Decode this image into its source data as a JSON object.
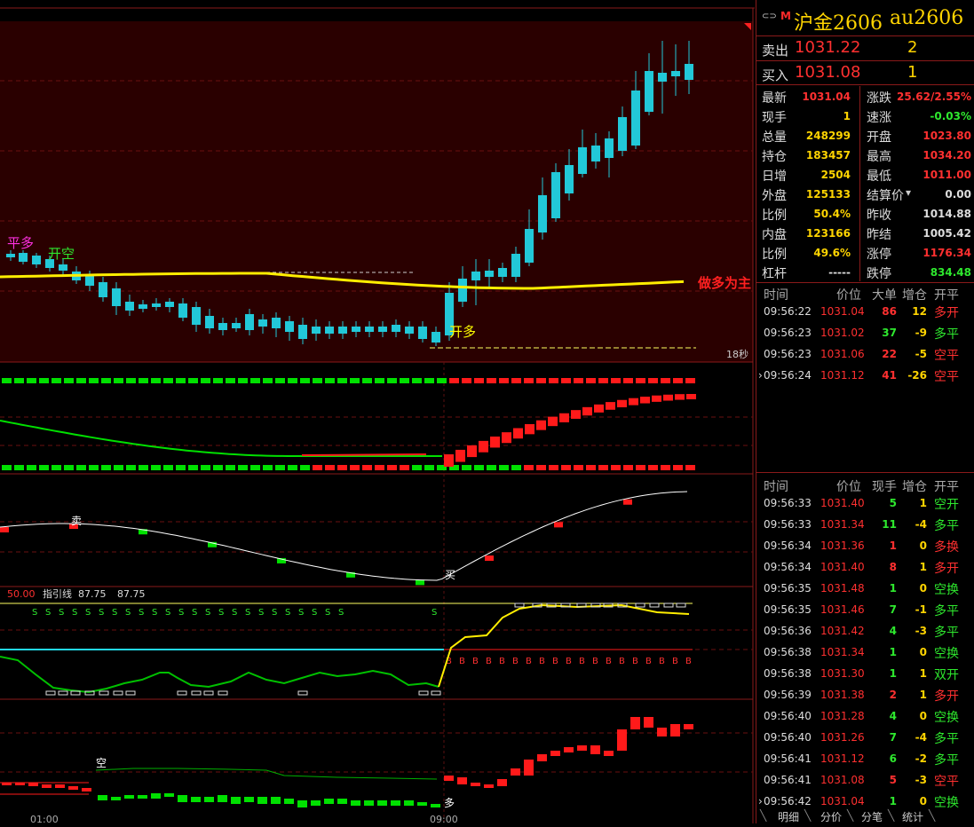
{
  "header": {
    "icon": "link-icon",
    "badge": "M",
    "name": "沪金2606",
    "code": "au2606"
  },
  "ask": {
    "label": "卖出",
    "price": "1031.22",
    "volume": "2"
  },
  "bid": {
    "label": "买入",
    "price": "1031.08",
    "volume": "1"
  },
  "stats_left": [
    {
      "k": "最新",
      "v": "1031.04",
      "color": "#ff3030"
    },
    {
      "k": "现手",
      "v": "1",
      "color": "#ffd400"
    },
    {
      "k": "总量",
      "v": "248299",
      "color": "#ffd400"
    },
    {
      "k": "持仓",
      "v": "183457",
      "color": "#ffd400"
    },
    {
      "k": "日增",
      "v": "2504",
      "color": "#ffd400"
    },
    {
      "k": "外盘",
      "v": "125133",
      "color": "#ffd400"
    },
    {
      "k": "比例",
      "v": "50.4%",
      "color": "#ffd400"
    },
    {
      "k": "内盘",
      "v": "123166",
      "color": "#ffd400"
    },
    {
      "k": "比例",
      "v": "49.6%",
      "color": "#ffd400"
    },
    {
      "k": "杠杆",
      "v": "-----",
      "color": "#ddd"
    }
  ],
  "stats_right": [
    {
      "k": "涨跌",
      "v": "25.62/2.55%",
      "color": "#ff3030"
    },
    {
      "k": "速涨",
      "v": "-0.03%",
      "color": "#2ee82e"
    },
    {
      "k": "开盘",
      "v": "1023.80",
      "color": "#ff3030"
    },
    {
      "k": "最高",
      "v": "1034.20",
      "color": "#ff3030"
    },
    {
      "k": "最低",
      "v": "1011.00",
      "color": "#ff3030"
    },
    {
      "k": "结算价",
      "v": "0.00",
      "color": "#ddd",
      "dropdown": true
    },
    {
      "k": "昨收",
      "v": "1014.88",
      "color": "#ddd"
    },
    {
      "k": "昨结",
      "v": "1005.42",
      "color": "#ddd"
    },
    {
      "k": "涨停",
      "v": "1176.34",
      "color": "#ff3030"
    },
    {
      "k": "跌停",
      "v": "834.48",
      "color": "#2ee82e"
    }
  ],
  "big_orders": {
    "headers": [
      "时间",
      "价位",
      "大单",
      "增仓",
      "开平"
    ],
    "rows": [
      {
        "t": "09:56:22",
        "p": "1031.04",
        "v": "86",
        "c": "12",
        "k": "多开",
        "vc": "#ff3030",
        "cc": "#ffd400",
        "kc": "#ff3030"
      },
      {
        "t": "09:56:23",
        "p": "1031.02",
        "v": "37",
        "c": "-9",
        "k": "多平",
        "vc": "#2ee82e",
        "cc": "#ffd400",
        "kc": "#2ee82e"
      },
      {
        "t": "09:56:23",
        "p": "1031.06",
        "v": "22",
        "c": "-5",
        "k": "空平",
        "vc": "#ff3030",
        "cc": "#ffd400",
        "kc": "#ff3030"
      },
      {
        "t": "09:56:24",
        "p": "1031.12",
        "v": "41",
        "c": "-26",
        "k": "空平",
        "vc": "#ff3030",
        "cc": "#ffd400",
        "kc": "#ff3030",
        "arrow": true
      }
    ]
  },
  "ticks": {
    "headers": [
      "时间",
      "价位",
      "现手",
      "增仓",
      "开平"
    ],
    "rows": [
      {
        "t": "09:56:33",
        "p": "1031.40",
        "v": "5",
        "c": "1",
        "k": "空开",
        "vc": "#2ee82e",
        "cc": "#ffd400",
        "kc": "#2ee82e"
      },
      {
        "t": "09:56:33",
        "p": "1031.34",
        "v": "11",
        "c": "-4",
        "k": "多平",
        "vc": "#2ee82e",
        "cc": "#ffd400",
        "kc": "#2ee82e"
      },
      {
        "t": "09:56:34",
        "p": "1031.36",
        "v": "1",
        "c": "0",
        "k": "多换",
        "vc": "#ff3030",
        "cc": "#ffd400",
        "kc": "#ff3030"
      },
      {
        "t": "09:56:34",
        "p": "1031.40",
        "v": "8",
        "c": "1",
        "k": "多开",
        "vc": "#ff3030",
        "cc": "#ffd400",
        "kc": "#ff3030"
      },
      {
        "t": "09:56:35",
        "p": "1031.48",
        "v": "1",
        "c": "0",
        "k": "空换",
        "vc": "#2ee82e",
        "cc": "#ffd400",
        "kc": "#2ee82e"
      },
      {
        "t": "09:56:35",
        "p": "1031.46",
        "v": "7",
        "c": "-1",
        "k": "多平",
        "vc": "#2ee82e",
        "cc": "#ffd400",
        "kc": "#2ee82e"
      },
      {
        "t": "09:56:36",
        "p": "1031.42",
        "v": "4",
        "c": "-3",
        "k": "多平",
        "vc": "#2ee82e",
        "cc": "#ffd400",
        "kc": "#2ee82e"
      },
      {
        "t": "09:56:38",
        "p": "1031.34",
        "v": "1",
        "c": "0",
        "k": "空换",
        "vc": "#2ee82e",
        "cc": "#ffd400",
        "kc": "#2ee82e"
      },
      {
        "t": "09:56:38",
        "p": "1031.30",
        "v": "1",
        "c": "1",
        "k": "双开",
        "vc": "#2ee82e",
        "cc": "#ffd400",
        "kc": "#2ee82e"
      },
      {
        "t": "09:56:39",
        "p": "1031.38",
        "v": "2",
        "c": "1",
        "k": "多开",
        "vc": "#ff3030",
        "cc": "#ffd400",
        "kc": "#ff3030"
      },
      {
        "t": "09:56:40",
        "p": "1031.28",
        "v": "4",
        "c": "0",
        "k": "空换",
        "vc": "#2ee82e",
        "cc": "#ffd400",
        "kc": "#2ee82e"
      },
      {
        "t": "09:56:40",
        "p": "1031.26",
        "v": "7",
        "c": "-4",
        "k": "多平",
        "vc": "#2ee82e",
        "cc": "#ffd400",
        "kc": "#2ee82e"
      },
      {
        "t": "09:56:41",
        "p": "1031.12",
        "v": "6",
        "c": "-2",
        "k": "多平",
        "vc": "#2ee82e",
        "cc": "#ffd400",
        "kc": "#2ee82e"
      },
      {
        "t": "09:56:41",
        "p": "1031.08",
        "v": "5",
        "c": "-3",
        "k": "空平",
        "vc": "#ff3030",
        "cc": "#ffd400",
        "kc": "#ff3030"
      },
      {
        "t": "09:56:42",
        "p": "1031.04",
        "v": "1",
        "c": "0",
        "k": "空换",
        "vc": "#2ee82e",
        "cc": "#ffd400",
        "kc": "#2ee82e",
        "arrow": true
      }
    ]
  },
  "tabs": [
    "明细",
    "分价",
    "分笔",
    "统计"
  ],
  "main_chart": {
    "labels": {
      "ping_duo": "平多",
      "kai_kong": "开空",
      "kai_duo": "开多",
      "trend": "做多为主",
      "interval": "18秒"
    }
  },
  "panel3": {
    "sell": "卖",
    "buy": "买"
  },
  "panel4": {
    "left_val": "50.00",
    "ind_label": "指引线",
    "v1": "87.75",
    "v2": "87.75"
  },
  "panel5": {
    "kong": "空",
    "duo": "多"
  },
  "time_axis": [
    "01:00",
    "09:00"
  ],
  "colors": {
    "up": "#ff1a1a",
    "down_cyan": "#22c8d8",
    "green": "#00e000",
    "yellow": "#ffff00",
    "grid": "#7a1010"
  }
}
